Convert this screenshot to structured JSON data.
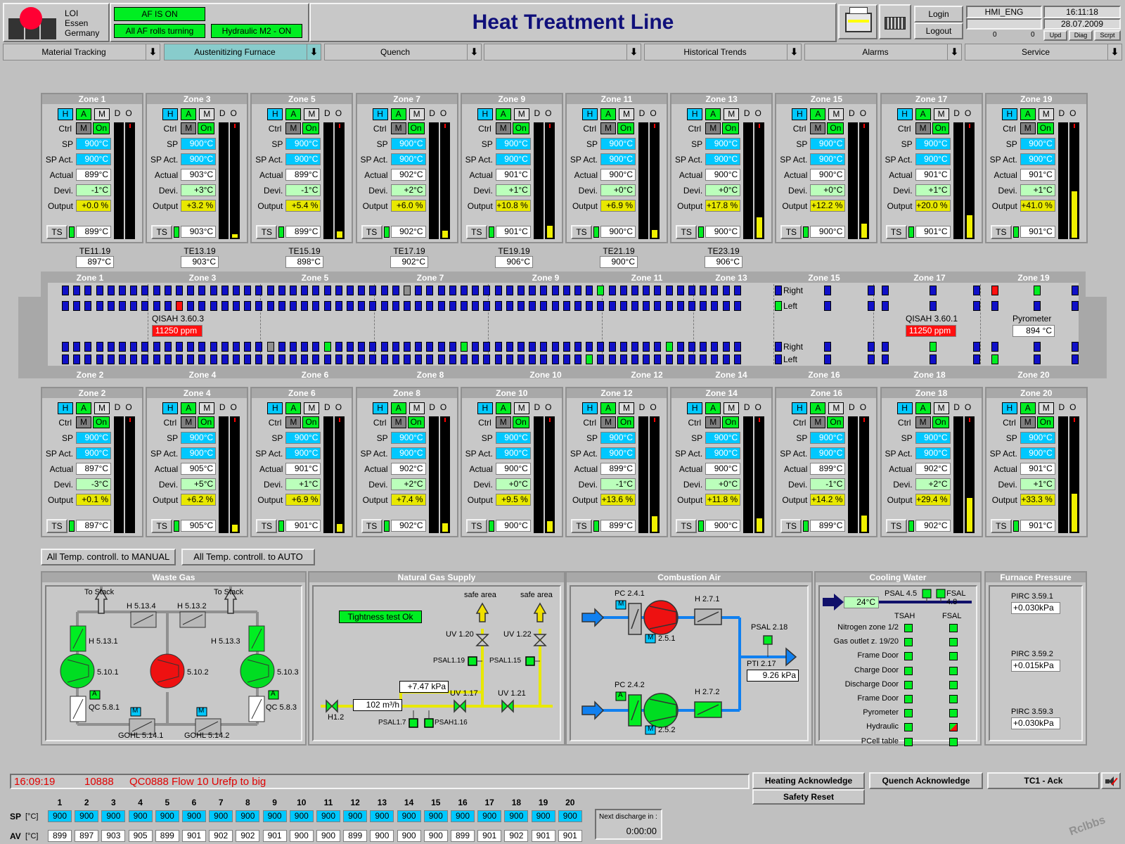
{
  "header": {
    "company": [
      "LOI",
      "Essen",
      "Germany"
    ],
    "af_on": "AF IS ON",
    "af_rolls": "All AF rolls turning",
    "hydraulic": "Hydraulic M2 - ON",
    "title": "Heat Treatment Line",
    "login": "Login",
    "logout": "Logout",
    "user": "HMI_ENG",
    "time": "16:11:18",
    "date": "28.07.2009",
    "count1": "0",
    "count2": "0",
    "upd": "Upd",
    "diag": "Diag",
    "scrpt": "Scrpt"
  },
  "nav": [
    "Material Tracking",
    "Austenitizing Furnace",
    "Quench",
    "",
    "Historical Trends",
    "Alarms",
    "Service"
  ],
  "zone_labels": {
    "h": "H",
    "a": "A",
    "m": "M",
    "d": "D",
    "o": "O",
    "ctrl": "Ctrl",
    "m2": "M",
    "on": "On",
    "sp": "SP",
    "spact": "SP Act.",
    "actual": "Actual",
    "devi": "Devi.",
    "output": "Output",
    "ts": "TS"
  },
  "top_zones": [
    {
      "name": "Zone 1",
      "sp": "900°C",
      "spact": "900°C",
      "actual": "899°C",
      "devi": "-1°C",
      "output": "+0.0 %",
      "ts": "899°C",
      "level": 0.0
    },
    {
      "name": "Zone 3",
      "sp": "900°C",
      "spact": "900°C",
      "actual": "903°C",
      "devi": "+3°C",
      "output": "+3.2 %",
      "ts": "903°C",
      "level": 0.032
    },
    {
      "name": "Zone 5",
      "sp": "900°C",
      "spact": "900°C",
      "actual": "899°C",
      "devi": "-1°C",
      "output": "+5.4 %",
      "ts": "899°C",
      "level": 0.054
    },
    {
      "name": "Zone 7",
      "sp": "900°C",
      "spact": "900°C",
      "actual": "902°C",
      "devi": "+2°C",
      "output": "+6.0 %",
      "ts": "902°C",
      "level": 0.06
    },
    {
      "name": "Zone 9",
      "sp": "900°C",
      "spact": "900°C",
      "actual": "901°C",
      "devi": "+1°C",
      "output": "+10.8 %",
      "ts": "901°C",
      "level": 0.108
    },
    {
      "name": "Zone 11",
      "sp": "900°C",
      "spact": "900°C",
      "actual": "900°C",
      "devi": "+0°C",
      "output": "+6.9 %",
      "ts": "900°C",
      "level": 0.069
    },
    {
      "name": "Zone 13",
      "sp": "900°C",
      "spact": "900°C",
      "actual": "900°C",
      "devi": "+0°C",
      "output": "+17.8 %",
      "ts": "900°C",
      "level": 0.178
    },
    {
      "name": "Zone 15",
      "sp": "900°C",
      "spact": "900°C",
      "actual": "900°C",
      "devi": "+0°C",
      "output": "+12.2 %",
      "ts": "900°C",
      "level": 0.122
    },
    {
      "name": "Zone 17",
      "sp": "900°C",
      "spact": "900°C",
      "actual": "901°C",
      "devi": "+1°C",
      "output": "+20.0 %",
      "ts": "901°C",
      "level": 0.2
    },
    {
      "name": "Zone 19",
      "sp": "900°C",
      "spact": "900°C",
      "actual": "901°C",
      "devi": "+1°C",
      "output": "+41.0 %",
      "ts": "901°C",
      "level": 0.41
    }
  ],
  "bottom_zones": [
    {
      "name": "Zone 2",
      "sp": "900°C",
      "spact": "900°C",
      "actual": "897°C",
      "devi": "-3°C",
      "output": "+0.1 %",
      "ts": "897°C",
      "level": 0.001
    },
    {
      "name": "Zone 4",
      "sp": "900°C",
      "spact": "900°C",
      "actual": "905°C",
      "devi": "+5°C",
      "output": "+6.2 %",
      "ts": "905°C",
      "level": 0.062
    },
    {
      "name": "Zone 6",
      "sp": "900°C",
      "spact": "900°C",
      "actual": "901°C",
      "devi": "+1°C",
      "output": "+6.9 %",
      "ts": "901°C",
      "level": 0.069
    },
    {
      "name": "Zone 8",
      "sp": "900°C",
      "spact": "900°C",
      "actual": "902°C",
      "devi": "+2°C",
      "output": "+7.4 %",
      "ts": "902°C",
      "level": 0.074
    },
    {
      "name": "Zone 10",
      "sp": "900°C",
      "spact": "900°C",
      "actual": "900°C",
      "devi": "+0°C",
      "output": "+9.5 %",
      "ts": "900°C",
      "level": 0.095
    },
    {
      "name": "Zone 12",
      "sp": "900°C",
      "spact": "900°C",
      "actual": "899°C",
      "devi": "-1°C",
      "output": "+13.6 %",
      "ts": "899°C",
      "level": 0.136
    },
    {
      "name": "Zone 14",
      "sp": "900°C",
      "spact": "900°C",
      "actual": "900°C",
      "devi": "+0°C",
      "output": "+11.8 %",
      "ts": "900°C",
      "level": 0.118
    },
    {
      "name": "Zone 16",
      "sp": "900°C",
      "spact": "900°C",
      "actual": "899°C",
      "devi": "-1°C",
      "output": "+14.2 %",
      "ts": "899°C",
      "level": 0.142
    },
    {
      "name": "Zone 18",
      "sp": "900°C",
      "spact": "900°C",
      "actual": "902°C",
      "devi": "+2°C",
      "output": "+29.4 %",
      "ts": "902°C",
      "level": 0.294
    },
    {
      "name": "Zone 20",
      "sp": "900°C",
      "spact": "900°C",
      "actual": "901°C",
      "devi": "+1°C",
      "output": "+33.3 %",
      "ts": "901°C",
      "level": 0.333
    }
  ],
  "te": [
    {
      "name": "TE11.19",
      "val": "897°C"
    },
    {
      "name": "TE13.19",
      "val": "903°C"
    },
    {
      "name": "TE15.19",
      "val": "898°C"
    },
    {
      "name": "TE17.19",
      "val": "902°C"
    },
    {
      "name": "TE19.19",
      "val": "906°C"
    },
    {
      "name": "TE21.19",
      "val": "900°C"
    },
    {
      "name": "TE23.19",
      "val": "906°C"
    }
  ],
  "furnace": {
    "top_zones": [
      "Zone 1",
      "Zone 3",
      "Zone 5",
      "Zone 7",
      "Zone 9",
      "Zone 11",
      "Zone 13",
      "Zone 15",
      "Zone 17",
      "Zone 19"
    ],
    "bottom_zones": [
      "Zone 2",
      "Zone 4",
      "Zone 6",
      "Zone 8",
      "Zone 10",
      "Zone 12",
      "Zone 14",
      "Zone 16",
      "Zone 18",
      "Zone 20"
    ],
    "right": "Right",
    "left": "Left",
    "qisah1": "QISAH 3.60.3",
    "qisah1_val": "11250 ppm",
    "qisah2": "QISAH 3.60.1",
    "qisah2_val": "11250 ppm",
    "pyrometer": "Pyrometer",
    "pyro_val": "894 °C"
  },
  "buttons": {
    "manual": "All Temp. controll. to MANUAL",
    "auto": "All Temp. controll. to AUTO"
  },
  "waste_gas": {
    "title": "Waste Gas",
    "stack1": "To Stack",
    "stack2": "To Stack",
    "h5134": "H 5.13.4",
    "h5132": "H 5.13.2",
    "h5131": "H 5.13.1",
    "h5133": "H 5.13.3",
    "f5101": "5.10.1",
    "f5102": "5.10.2",
    "f5103": "5.10.3",
    "qc581": "QC 5.8.1",
    "qc583": "QC 5.8.3",
    "gohl1": "GOHL 5.14.1",
    "gohl2": "GOHL 5.14.2",
    "a": "A",
    "m": "M"
  },
  "natural_gas": {
    "title": "Natural Gas Supply",
    "tight": "Tightness test Ok",
    "safe1": "safe area",
    "safe2": "safe area",
    "uv120": "UV 1.20",
    "uv122": "UV 1.22",
    "psal119": "PSAL1.19",
    "psal115": "PSAL1.15",
    "pressure": "+7.47 kPa",
    "uv117": "UV 1.17",
    "uv121": "UV 1.21",
    "flow": "102 m³/h",
    "h12": "H1.2",
    "psal17": "PSAL1.7",
    "psah116": "PSAH1.16"
  },
  "combustion": {
    "title": "Combustion Air",
    "pc241": "PC 2.4.1",
    "pc242": "PC 2.4.2",
    "h271": "H 2.7.1",
    "h272": "H 2.7.2",
    "f251": "2.5.1",
    "f252": "2.5.2",
    "psal218": "PSAL 2.18",
    "pti217": "PTI 2.17",
    "pti_val": "9.26 kPa",
    "m": "M",
    "a": "A"
  },
  "cooling": {
    "title": "Cooling Water",
    "psal45": "PSAL 4.5",
    "psal48": "FSAL 4.8",
    "temp": "24°C",
    "tsah": "TSAH",
    "fsal": "FSAL",
    "rows": [
      "Nitrogen zone 1/2",
      "Gas outlet z. 19/20",
      "Frame Door",
      "Charge Door",
      "Discharge Door",
      "Frame Door",
      "Pyrometer",
      "Hydraulic",
      "PCell table"
    ]
  },
  "pressure": {
    "title": "Furnace Pressure",
    "items": [
      {
        "name": "PIRC 3.59.1",
        "val": "+0.030kPa"
      },
      {
        "name": "PIRC 3.59.2",
        "val": "+0.015kPa"
      },
      {
        "name": "PIRC 3.59.3",
        "val": "+0.030kPa"
      }
    ]
  },
  "alarm": {
    "time": "16:09:19",
    "code": "10888",
    "text": "QC0888 Flow 10 Urefp to big"
  },
  "ack": {
    "heating": "Heating Acknowledge",
    "quench": "Quench Acknowledge",
    "tc1": "TC1 - Ack",
    "safety": "Safety Reset"
  },
  "table": {
    "sp_label": "SP",
    "av_label": "AV",
    "unit": "[°C]",
    "cols": [
      "1",
      "2",
      "3",
      "4",
      "5",
      "6",
      "7",
      "8",
      "9",
      "10",
      "11",
      "12",
      "13",
      "14",
      "15",
      "16",
      "17",
      "18",
      "19",
      "20"
    ],
    "sp": [
      "900",
      "900",
      "900",
      "900",
      "900",
      "900",
      "900",
      "900",
      "900",
      "900",
      "900",
      "900",
      "900",
      "900",
      "900",
      "900",
      "900",
      "900",
      "900",
      "900"
    ],
    "av": [
      "899",
      "897",
      "903",
      "905",
      "899",
      "901",
      "902",
      "902",
      "901",
      "900",
      "900",
      "899",
      "900",
      "900",
      "900",
      "899",
      "901",
      "902",
      "901",
      "901"
    ]
  },
  "discharge": {
    "label": "Next discharge in :",
    "val": "0:00:00"
  },
  "watermark": "Rclbbs",
  "colors": {
    "green": "#00ee22",
    "cyan": "#00c8ff",
    "blue": "#1010c8",
    "red": "#ff1010",
    "yellow": "#e8e800"
  }
}
